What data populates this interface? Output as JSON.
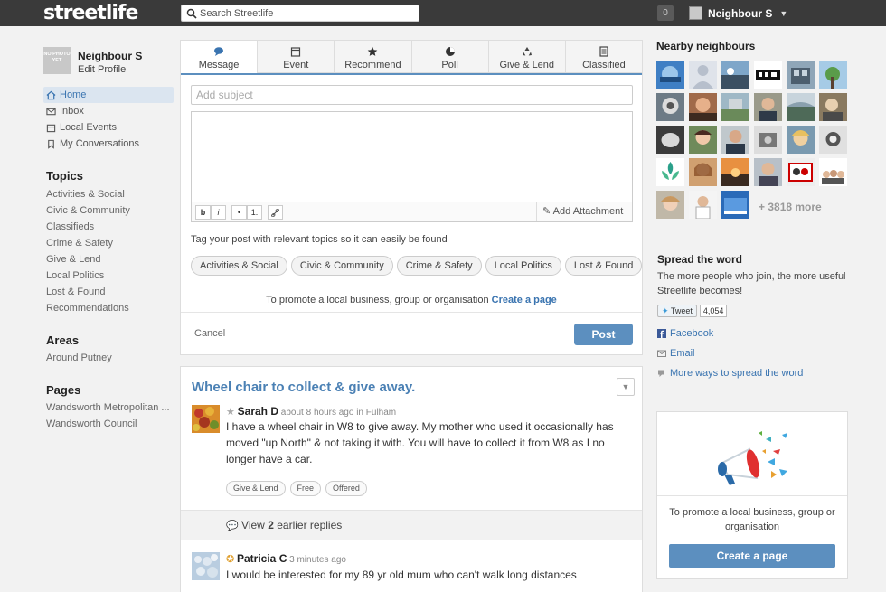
{
  "brand": "streetlife",
  "search": {
    "placeholder": "Search Streetlife"
  },
  "notif_count": "0",
  "user": {
    "name": "Neighbour S",
    "edit_label": "Edit Profile",
    "no_photo": "NO PHOTO YET"
  },
  "nav": [
    {
      "label": "Home",
      "icon": "home-icon",
      "active": true
    },
    {
      "label": "Inbox",
      "icon": "mail-icon"
    },
    {
      "label": "Local Events",
      "icon": "calendar-icon"
    },
    {
      "label": "My Conversations",
      "icon": "bookmark-icon"
    }
  ],
  "topics": {
    "heading": "Topics",
    "items": [
      "Activities & Social",
      "Civic & Community",
      "Classifieds",
      "Crime & Safety",
      "Give & Lend",
      "Local Politics",
      "Lost & Found",
      "Recommendations"
    ]
  },
  "areas": {
    "heading": "Areas",
    "items": [
      "Around Putney"
    ]
  },
  "pages": {
    "heading": "Pages",
    "items": [
      "Wandsworth Metropolitan ...",
      "Wandsworth Council"
    ]
  },
  "composer": {
    "tabs": [
      {
        "label": "Message",
        "icon": "speech-bubble-icon",
        "active": true
      },
      {
        "label": "Event",
        "icon": "calendar-icon"
      },
      {
        "label": "Recommend",
        "icon": "star-icon"
      },
      {
        "label": "Poll",
        "icon": "pie-chart-icon"
      },
      {
        "label": "Give & Lend",
        "icon": "recycle-icon"
      },
      {
        "label": "Classified",
        "icon": "document-icon"
      }
    ],
    "subject_placeholder": "Add subject",
    "toolbar": {
      "bold": "b",
      "italic": "i",
      "bullet": "•",
      "numbered": "1.",
      "attach": "Add Attachment"
    },
    "tag_hint": "Tag your post with relevant topics so it can easily be found",
    "chips": [
      "Activities & Social",
      "Civic & Community",
      "Crime & Safety",
      "Local Politics",
      "Lost & Found"
    ],
    "promo_text": "To promote a local business, group or organisation",
    "promo_link": "Create a page",
    "cancel": "Cancel",
    "post": "Post"
  },
  "feed": {
    "title": "Wheel chair to collect & give away.",
    "post": {
      "author": "Sarah D",
      "time": "about 8 hours ago",
      "location_prefix": "in",
      "location": "Fulham",
      "lines": [
        "I have a wheel chair in W8 to give away.  My mother who used it occasionally has",
        "moved \"up North\" & not taking it with.  You will have to collect it from W8 as I no",
        "longer have a car."
      ],
      "tags": [
        "Give & Lend",
        "Free",
        "Offered"
      ]
    },
    "earlier_prefix": "View",
    "earlier_count": "2",
    "earlier_suffix": "earlier replies",
    "reply": {
      "author": "Patricia C",
      "time": "3 minutes ago",
      "text": "I would be interested for my 89 yr old mum who can't walk long distances"
    }
  },
  "right": {
    "neighbours_heading": "Nearby neighbours",
    "more_count": "+ 3818 more",
    "spread_heading": "Spread the word",
    "spread_text": "The more people who join, the more useful Streetlife becomes!",
    "tweet_label": "Tweet",
    "tweet_count": "4,054",
    "facebook": "Facebook",
    "email": "Email",
    "more_ways": "More ways to spread the word",
    "promo_text": "To promote a local business, group or organisation",
    "promo_button": "Create a page"
  },
  "colors": {
    "accent": "#5c8fbf",
    "link": "#3a74b0",
    "topbar": "#3a3a3a"
  }
}
